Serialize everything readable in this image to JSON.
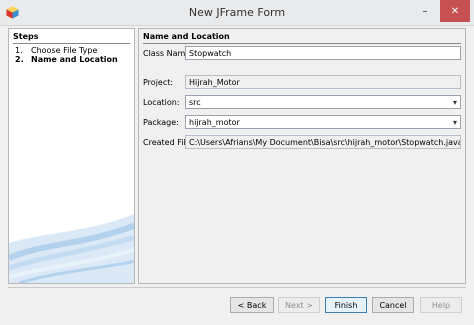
{
  "window": {
    "title": "New JFrame Form",
    "minimize": "–",
    "close": "✕",
    "icon": "netbeans-icon"
  },
  "steps": {
    "header": "Steps",
    "items": [
      {
        "num": "1.",
        "label": "Choose File Type"
      },
      {
        "num": "2.",
        "label": "Name and Location"
      }
    ]
  },
  "form": {
    "header": "Name and Location",
    "class_name": {
      "label": "Class Name:",
      "value": "Stopwatch"
    },
    "project": {
      "label": "Project:",
      "value": "Hijrah_Motor"
    },
    "location": {
      "label": "Location:",
      "value": "src"
    },
    "package": {
      "label": "Package:",
      "value": "hijrah_motor"
    },
    "created_file": {
      "label": "Created File:",
      "value": "C:\\Users\\Afrians\\My Document\\Bisa\\src\\hijrah_motor\\Stopwatch.java"
    }
  },
  "buttons": {
    "back": "< Back",
    "next": "Next >",
    "finish": "Finish",
    "cancel": "Cancel",
    "help": "Help"
  },
  "colors": {
    "accent": "#3c7fb1",
    "close": "#c75050"
  }
}
